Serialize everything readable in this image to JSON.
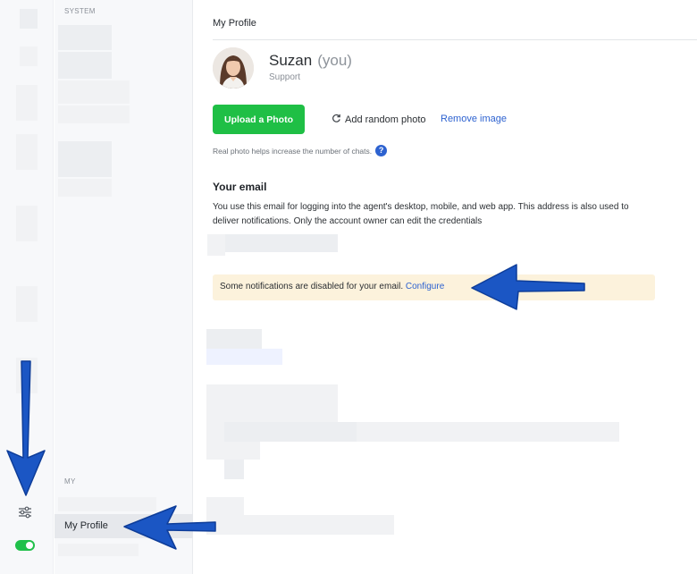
{
  "sidebar": {
    "system_heading": "SYSTEM",
    "my_heading": "MY",
    "active_item": "My Profile",
    "settings_icon": "sliders-icon",
    "status_toggle": "on"
  },
  "header": {
    "title": "My Profile"
  },
  "profile": {
    "name": "Suzan",
    "you_tag": "(you)",
    "role": "Support",
    "avatar_icon": "user-avatar"
  },
  "photo": {
    "upload_label": "Upload a Photo",
    "random_label": "Add random photo",
    "remove_label": "Remove image",
    "hint": "Real photo helps increase the number of chats.",
    "help_icon": "?"
  },
  "email": {
    "heading": "Your email",
    "description": "You use this email for logging into the agent's desktop, mobile, and web app. This address is also used to deliver notifications. Only the account owner can edit the credentials"
  },
  "notice": {
    "text": "Some notifications are disabled for your email.",
    "link": "Configure"
  },
  "colors": {
    "accent_green": "#1fbf45",
    "link_blue": "#2d62d0",
    "notice_bg": "#fcf2dc",
    "annotation_arrow": "#1b56c4"
  }
}
